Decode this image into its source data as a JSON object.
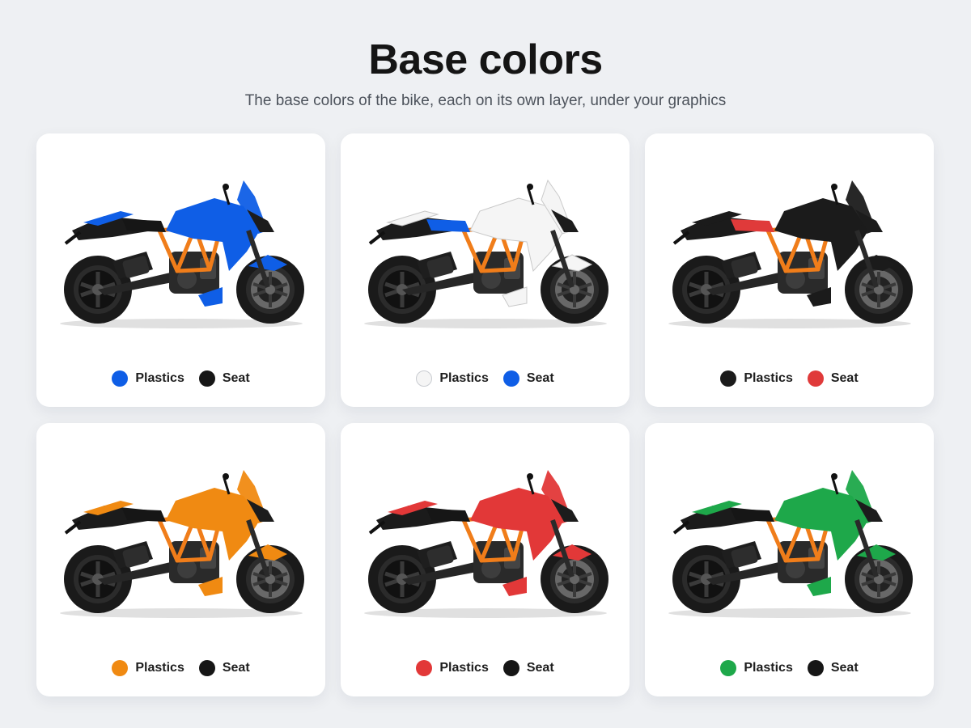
{
  "header": {
    "title": "Base colors",
    "subtitle": "The base colors of the bike, each on its own layer, under your graphics"
  },
  "cards": [
    {
      "plastics_color": "#0f5ee6",
      "seat_color": "#161616",
      "legend": [
        {
          "label": "Plastics",
          "color": "#0f5ee6"
        },
        {
          "label": "Seat",
          "color": "#161616"
        }
      ]
    },
    {
      "plastics_color": "#f5f5f5",
      "seat_color": "#0f5ee6",
      "legend": [
        {
          "label": "Plastics",
          "color": "#f5f5f5"
        },
        {
          "label": "Seat",
          "color": "#0f5ee6"
        }
      ]
    },
    {
      "plastics_color": "#1b1b1b",
      "seat_color": "#e03a3a",
      "legend": [
        {
          "label": "Plastics",
          "color": "#1b1b1b"
        },
        {
          "label": "Seat",
          "color": "#e03a3a"
        }
      ]
    },
    {
      "plastics_color": "#f08a12",
      "seat_color": "#161616",
      "legend": [
        {
          "label": "Plastics",
          "color": "#f08a12"
        },
        {
          "label": "Seat",
          "color": "#161616"
        }
      ]
    },
    {
      "plastics_color": "#e23838",
      "seat_color": "#161616",
      "legend": [
        {
          "label": "Plastics",
          "color": "#e23838"
        },
        {
          "label": "Seat",
          "color": "#161616"
        }
      ]
    },
    {
      "plastics_color": "#1ea84a",
      "seat_color": "#161616",
      "legend": [
        {
          "label": "Plastics",
          "color": "#1ea84a"
        },
        {
          "label": "Seat",
          "color": "#161616"
        }
      ]
    }
  ],
  "frame_color": "#f07d1a",
  "icons": {
    "bike": "motorcycle-illustration",
    "swatch": "color-swatch-dot"
  }
}
